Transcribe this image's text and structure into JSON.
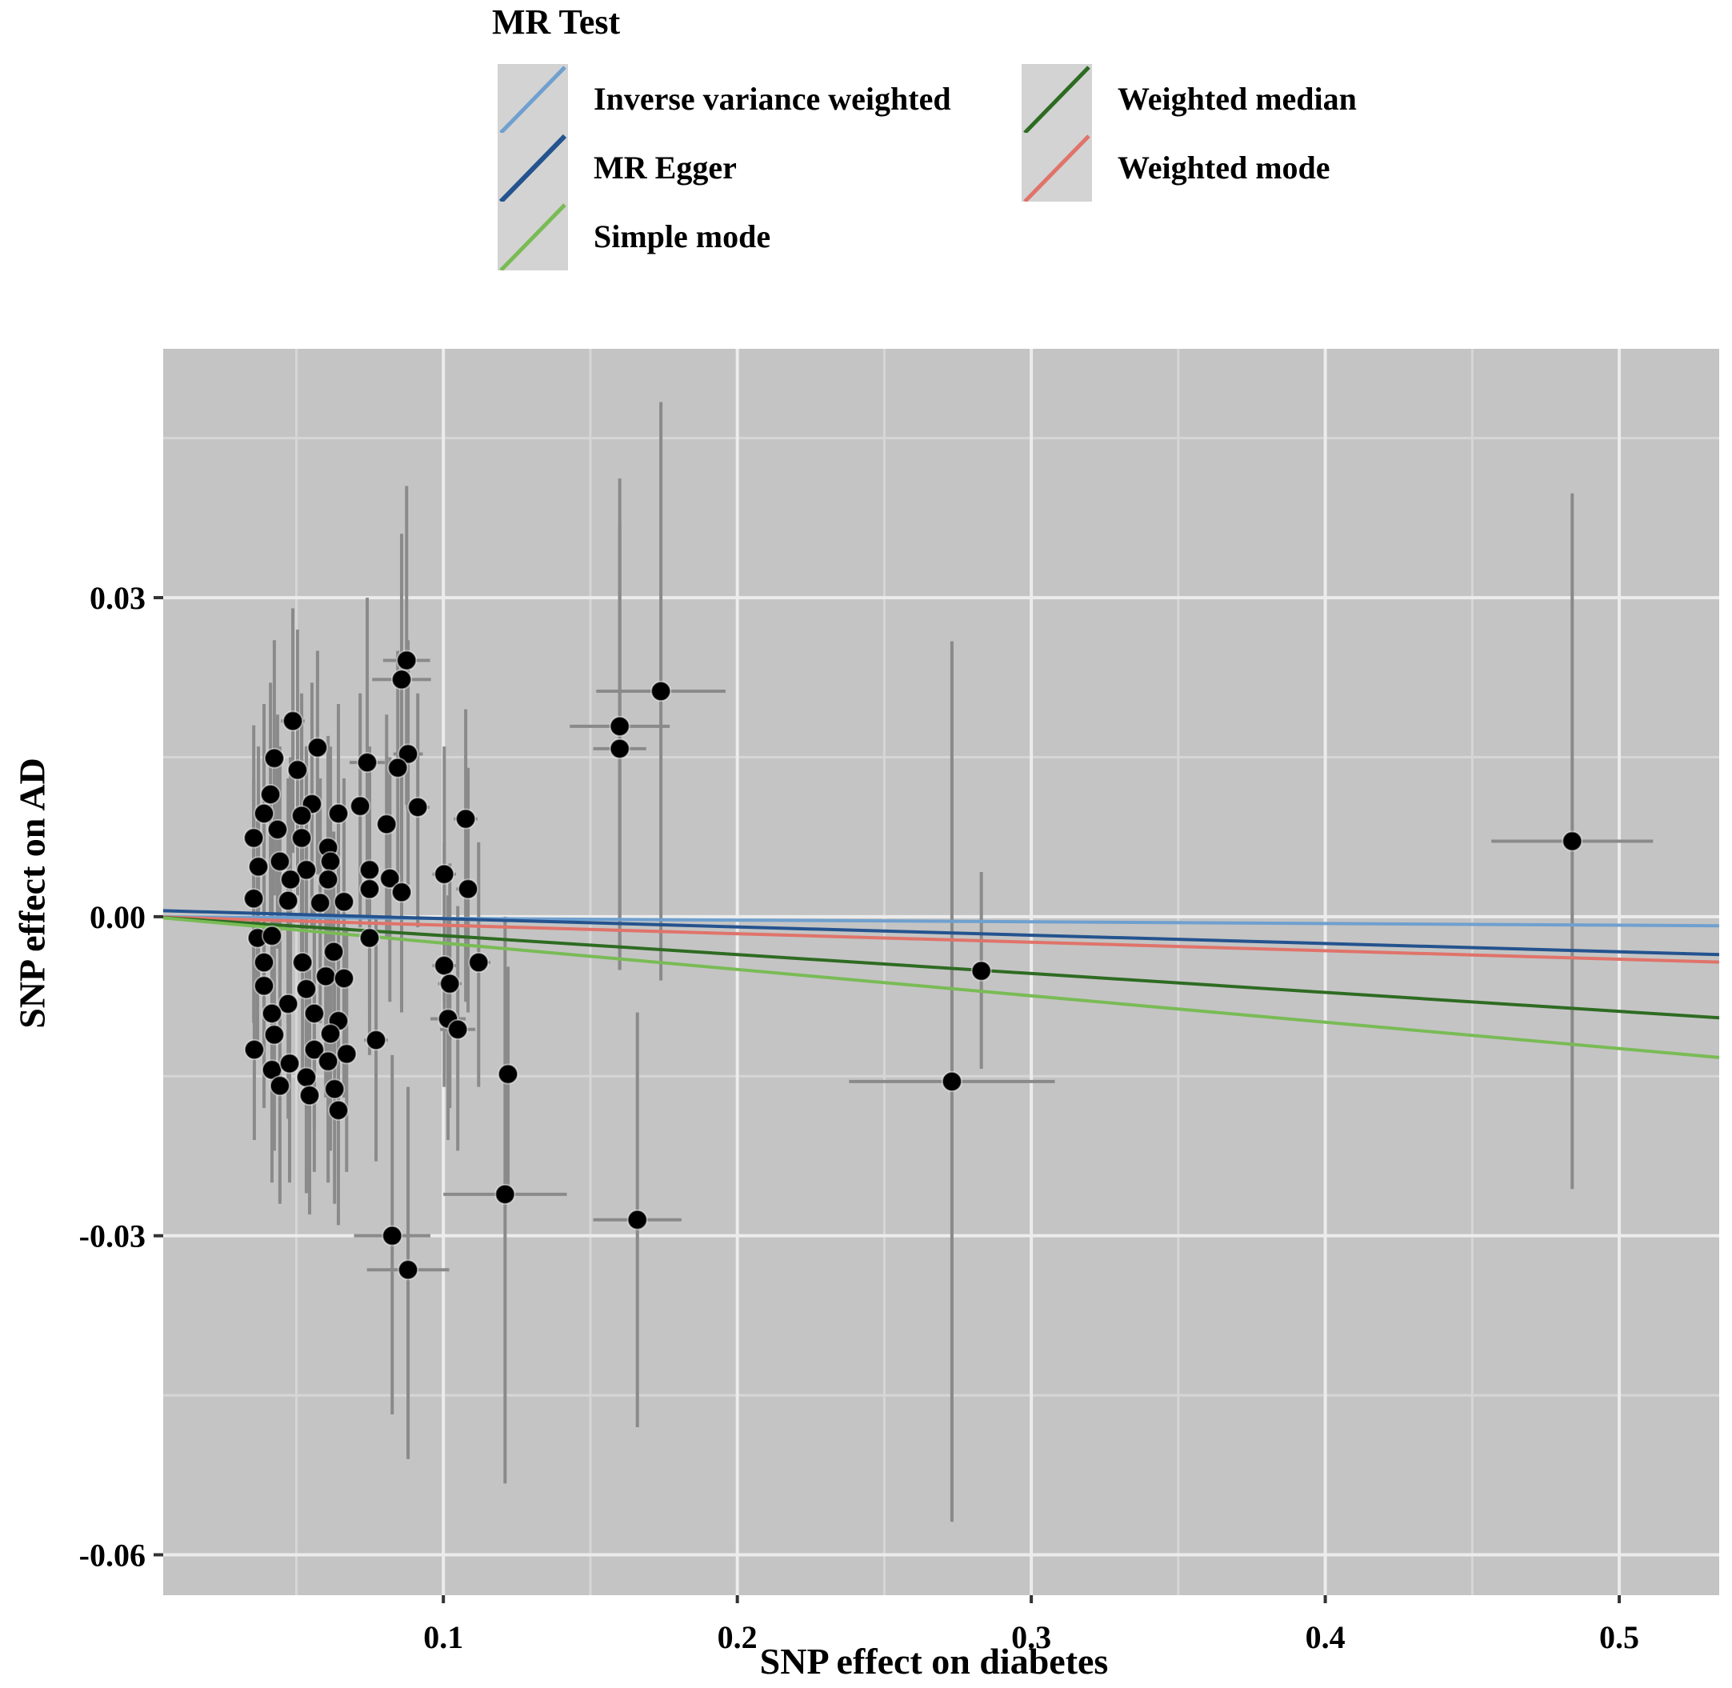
{
  "chart_data": {
    "type": "scatter",
    "title": "",
    "xlabel": "SNP effect on diabetes",
    "ylabel": "SNP effect on AD",
    "xlim": [
      0.0047,
      0.534
    ],
    "ylim": [
      -0.0638,
      0.0534
    ],
    "x_ticks": [
      0.1,
      0.2,
      0.3,
      0.4,
      0.5
    ],
    "x_tick_labels": [
      "0.1",
      "0.2",
      "0.3",
      "0.4",
      "0.5"
    ],
    "y_ticks": [
      0.03,
      0.0,
      -0.03,
      -0.06
    ],
    "y_tick_labels": [
      "0.03",
      "0.00",
      "-0.03",
      "-0.06"
    ],
    "grid": true,
    "background": "#c4c4c4",
    "legend": {
      "title": "MR Test",
      "placement": "top",
      "entries": [
        {
          "name": "Inverse variance weighted",
          "color": "#6fa0cf"
        },
        {
          "name": "MR Egger",
          "color": "#24538f"
        },
        {
          "name": "Simple mode",
          "color": "#79bb55"
        },
        {
          "name": "Weighted median",
          "color": "#2e6b22"
        },
        {
          "name": "Weighted mode",
          "color": "#e0736a"
        }
      ]
    },
    "lines": [
      {
        "name": "Inverse variance weighted",
        "intercept": 0.0,
        "slope": -0.0016,
        "color": "#6fa0cf"
      },
      {
        "name": "MR Egger",
        "intercept": 0.0006,
        "slope": -0.0078,
        "color": "#24538f"
      },
      {
        "name": "Weighted mode",
        "intercept": 0.0,
        "slope": -0.008,
        "color": "#e0736a"
      },
      {
        "name": "Weighted median",
        "intercept": 0.0,
        "slope": -0.0178,
        "color": "#2e6b22"
      },
      {
        "name": "Simple mode",
        "intercept": 0.0,
        "slope": -0.0248,
        "color": "#79bb55"
      }
    ],
    "points": [
      {
        "x": 0.0875,
        "y": 0.0241,
        "xerr": 0.008,
        "ylo": 0.0105,
        "yhi": 0.0405
      },
      {
        "x": 0.0858,
        "y": 0.0223,
        "xerr": 0.01,
        "ylo": 0.008,
        "yhi": 0.036
      },
      {
        "x": 0.0488,
        "y": 0.0184,
        "xerr": 0.004,
        "ylo": 0.006,
        "yhi": 0.029
      },
      {
        "x": 0.0572,
        "y": 0.0159,
        "xerr": 0.004,
        "ylo": 0.004,
        "yhi": 0.025
      },
      {
        "x": 0.0425,
        "y": 0.0149,
        "xerr": 0.003,
        "ylo": 0.002,
        "yhi": 0.026
      },
      {
        "x": 0.0504,
        "y": 0.0138,
        "xerr": 0.003,
        "ylo": 0.002,
        "yhi": 0.027
      },
      {
        "x": 0.0741,
        "y": 0.0145,
        "xerr": 0.006,
        "ylo": 0.0,
        "yhi": 0.03
      },
      {
        "x": 0.088,
        "y": 0.0153,
        "xerr": 0.005,
        "ylo": 0.003,
        "yhi": 0.026
      },
      {
        "x": 0.0845,
        "y": 0.014,
        "xerr": 0.004,
        "ylo": 0.002,
        "yhi": 0.025
      },
      {
        "x": 0.0412,
        "y": 0.0115,
        "xerr": 0.003,
        "ylo": 0.0,
        "yhi": 0.022
      },
      {
        "x": 0.0913,
        "y": 0.0103,
        "xerr": 0.004,
        "ylo": -0.001,
        "yhi": 0.021
      },
      {
        "x": 0.1076,
        "y": 0.0092,
        "xerr": 0.004,
        "ylo": -0.008,
        "yhi": 0.0195
      },
      {
        "x": 0.0643,
        "y": 0.0097,
        "xerr": 0.003,
        "ylo": -0.002,
        "yhi": 0.02
      },
      {
        "x": 0.0717,
        "y": 0.0104,
        "xerr": 0.003,
        "ylo": -0.001,
        "yhi": 0.021
      },
      {
        "x": 0.0807,
        "y": 0.0087,
        "xerr": 0.003,
        "ylo": -0.002,
        "yhi": 0.019
      },
      {
        "x": 0.0553,
        "y": 0.0106,
        "xerr": 0.003,
        "ylo": -0.001,
        "yhi": 0.022
      },
      {
        "x": 0.0518,
        "y": 0.0095,
        "xerr": 0.003,
        "ylo": -0.002,
        "yhi": 0.021
      },
      {
        "x": 0.039,
        "y": 0.0097,
        "xerr": 0.003,
        "ylo": -0.002,
        "yhi": 0.02
      },
      {
        "x": 0.0355,
        "y": 0.0074,
        "xerr": 0.003,
        "ylo": -0.004,
        "yhi": 0.018
      },
      {
        "x": 0.0436,
        "y": 0.0082,
        "xerr": 0.003,
        "ylo": -0.003,
        "yhi": 0.019
      },
      {
        "x": 0.0518,
        "y": 0.0074,
        "xerr": 0.003,
        "ylo": -0.004,
        "yhi": 0.018
      },
      {
        "x": 0.0608,
        "y": 0.0065,
        "xerr": 0.003,
        "ylo": -0.005,
        "yhi": 0.017
      },
      {
        "x": 0.0616,
        "y": 0.0052,
        "xerr": 0.003,
        "ylo": -0.006,
        "yhi": 0.016
      },
      {
        "x": 0.0371,
        "y": 0.0047,
        "xerr": 0.003,
        "ylo": -0.007,
        "yhi": 0.016
      },
      {
        "x": 0.0444,
        "y": 0.0052,
        "xerr": 0.003,
        "ylo": -0.006,
        "yhi": 0.016
      },
      {
        "x": 0.0534,
        "y": 0.0044,
        "xerr": 0.003,
        "ylo": -0.007,
        "yhi": 0.016
      },
      {
        "x": 0.1003,
        "y": 0.004,
        "xerr": 0.004,
        "ylo": -0.008,
        "yhi": 0.016
      },
      {
        "x": 0.0749,
        "y": 0.0044,
        "xerr": 0.003,
        "ylo": -0.007,
        "yhi": 0.016
      },
      {
        "x": 0.0818,
        "y": 0.0036,
        "xerr": 0.003,
        "ylo": -0.008,
        "yhi": 0.015
      },
      {
        "x": 0.1084,
        "y": 0.0026,
        "xerr": 0.004,
        "ylo": -0.009,
        "yhi": 0.014
      },
      {
        "x": 0.0608,
        "y": 0.0035,
        "xerr": 0.003,
        "ylo": -0.008,
        "yhi": 0.015
      },
      {
        "x": 0.048,
        "y": 0.0035,
        "xerr": 0.003,
        "ylo": -0.008,
        "yhi": 0.015
      },
      {
        "x": 0.0355,
        "y": 0.0017,
        "xerr": 0.003,
        "ylo": -0.01,
        "yhi": 0.013
      },
      {
        "x": 0.0472,
        "y": 0.0015,
        "xerr": 0.003,
        "ylo": -0.01,
        "yhi": 0.013
      },
      {
        "x": 0.0581,
        "y": 0.0013,
        "xerr": 0.003,
        "ylo": -0.01,
        "yhi": 0.013
      },
      {
        "x": 0.0662,
        "y": 0.0014,
        "xerr": 0.003,
        "ylo": -0.01,
        "yhi": 0.013
      },
      {
        "x": 0.0749,
        "y": 0.0026,
        "xerr": 0.003,
        "ylo": -0.009,
        "yhi": 0.014
      },
      {
        "x": 0.0858,
        "y": 0.0023,
        "xerr": 0.003,
        "ylo": -0.009,
        "yhi": 0.014
      },
      {
        "x": 0.0368,
        "y": -0.002,
        "xerr": 0.003,
        "ylo": -0.013,
        "yhi": 0.009
      },
      {
        "x": 0.0417,
        "y": -0.0018,
        "xerr": 0.003,
        "ylo": -0.013,
        "yhi": 0.009
      },
      {
        "x": 0.0749,
        "y": -0.002,
        "xerr": 0.003,
        "ylo": -0.013,
        "yhi": 0.009
      },
      {
        "x": 0.0627,
        "y": -0.0033,
        "xerr": 0.003,
        "ylo": -0.014,
        "yhi": 0.008
      },
      {
        "x": 0.039,
        "y": -0.0043,
        "xerr": 0.003,
        "ylo": -0.015,
        "yhi": 0.007
      },
      {
        "x": 0.0521,
        "y": -0.0043,
        "xerr": 0.003,
        "ylo": -0.015,
        "yhi": 0.007
      },
      {
        "x": 0.039,
        "y": -0.0065,
        "xerr": 0.003,
        "ylo": -0.018,
        "yhi": 0.005
      },
      {
        "x": 0.0534,
        "y": -0.0068,
        "xerr": 0.003,
        "ylo": -0.018,
        "yhi": 0.005
      },
      {
        "x": 0.06,
        "y": -0.0056,
        "xerr": 0.003,
        "ylo": -0.017,
        "yhi": 0.006
      },
      {
        "x": 0.0662,
        "y": -0.0058,
        "xerr": 0.003,
        "ylo": -0.017,
        "yhi": 0.006
      },
      {
        "x": 0.0472,
        "y": -0.0082,
        "xerr": 0.003,
        "ylo": -0.019,
        "yhi": 0.003
      },
      {
        "x": 0.0417,
        "y": -0.0091,
        "xerr": 0.003,
        "ylo": -0.02,
        "yhi": 0.002
      },
      {
        "x": 0.0561,
        "y": -0.0091,
        "xerr": 0.003,
        "ylo": -0.02,
        "yhi": 0.002
      },
      {
        "x": 0.0643,
        "y": -0.0098,
        "xerr": 0.003,
        "ylo": -0.021,
        "yhi": 0.001
      },
      {
        "x": 0.0425,
        "y": -0.0111,
        "xerr": 0.003,
        "ylo": -0.022,
        "yhi": 0.0
      },
      {
        "x": 0.0616,
        "y": -0.011,
        "xerr": 0.003,
        "ylo": -0.022,
        "yhi": 0.0
      },
      {
        "x": 0.0357,
        "y": -0.0125,
        "xerr": 0.003,
        "ylo": -0.021,
        "yhi": -0.004
      },
      {
        "x": 0.0771,
        "y": -0.0116,
        "xerr": 0.004,
        "ylo": -0.023,
        "yhi": 0.0
      },
      {
        "x": 0.0561,
        "y": -0.0125,
        "xerr": 0.003,
        "ylo": -0.024,
        "yhi": -0.001
      },
      {
        "x": 0.0671,
        "y": -0.0129,
        "xerr": 0.003,
        "ylo": -0.024,
        "yhi": -0.001
      },
      {
        "x": 0.0608,
        "y": -0.0136,
        "xerr": 0.003,
        "ylo": -0.025,
        "yhi": -0.002
      },
      {
        "x": 0.0417,
        "y": -0.0144,
        "xerr": 0.003,
        "ylo": -0.025,
        "yhi": -0.003
      },
      {
        "x": 0.0477,
        "y": -0.0138,
        "xerr": 0.003,
        "ylo": -0.025,
        "yhi": -0.002
      },
      {
        "x": 0.0444,
        "y": -0.0159,
        "xerr": 0.003,
        "ylo": -0.027,
        "yhi": -0.004
      },
      {
        "x": 0.0534,
        "y": -0.0151,
        "xerr": 0.003,
        "ylo": -0.026,
        "yhi": -0.004
      },
      {
        "x": 0.0545,
        "y": -0.0168,
        "xerr": 0.003,
        "ylo": -0.028,
        "yhi": -0.005
      },
      {
        "x": 0.063,
        "y": -0.0162,
        "xerr": 0.003,
        "ylo": -0.027,
        "yhi": -0.005
      },
      {
        "x": 0.0643,
        "y": -0.0182,
        "xerr": 0.003,
        "ylo": -0.029,
        "yhi": -0.007
      },
      {
        "x": 0.1003,
        "y": -0.0046,
        "xerr": 0.004,
        "ylo": -0.016,
        "yhi": 0.007
      },
      {
        "x": 0.1022,
        "y": -0.0063,
        "xerr": 0.004,
        "ylo": -0.018,
        "yhi": 0.005
      },
      {
        "x": 0.112,
        "y": -0.0043,
        "xerr": 0.004,
        "ylo": -0.016,
        "yhi": 0.007
      },
      {
        "x": 0.1016,
        "y": -0.0096,
        "xerr": 0.006,
        "ylo": -0.021,
        "yhi": 0.002
      },
      {
        "x": 0.1049,
        "y": -0.0106,
        "xerr": 0.006,
        "ylo": -0.022,
        "yhi": 0.001
      },
      {
        "x": 0.122,
        "y": -0.0148,
        "xerr": 0.003,
        "ylo": -0.026,
        "yhi": -0.0047
      },
      {
        "x": 0.121,
        "y": -0.0261,
        "xerr": 0.021,
        "ylo": -0.0533,
        "yhi": 0.0
      },
      {
        "x": 0.0826,
        "y": -0.03,
        "xerr": 0.013,
        "ylo": -0.0468,
        "yhi": -0.013
      },
      {
        "x": 0.088,
        "y": -0.0332,
        "xerr": 0.014,
        "ylo": -0.051,
        "yhi": -0.016
      },
      {
        "x": 0.174,
        "y": 0.0212,
        "xerr": 0.022,
        "ylo": -0.006,
        "yhi": 0.0484
      },
      {
        "x": 0.16,
        "y": 0.0179,
        "xerr": 0.017,
        "ylo": -0.005,
        "yhi": 0.0412
      },
      {
        "x": 0.16,
        "y": 0.0158,
        "xerr": 0.009,
        "ylo": -0.005,
        "yhi": 0.037
      },
      {
        "x": 0.166,
        "y": -0.0285,
        "xerr": 0.015,
        "ylo": -0.048,
        "yhi": -0.009
      },
      {
        "x": 0.273,
        "y": -0.0155,
        "xerr": 0.035,
        "ylo": -0.0569,
        "yhi": 0.0259
      },
      {
        "x": 0.283,
        "y": -0.0051,
        "xerr": 0.003,
        "ylo": -0.0143,
        "yhi": 0.0042
      },
      {
        "x": 0.484,
        "y": 0.0071,
        "xerr": 0.0275,
        "ylo": -0.0256,
        "yhi": 0.0398
      }
    ]
  }
}
